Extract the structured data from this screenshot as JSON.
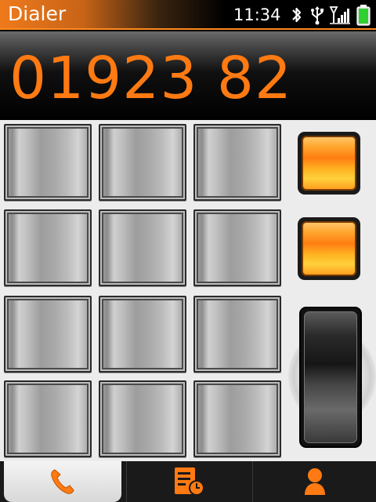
{
  "status_bar": {
    "title": "Dialer",
    "time": "11:34",
    "icons": [
      "bluetooth-icon",
      "usb-icon",
      "signal-icon",
      "battery-icon"
    ],
    "battery_color": "#2fd02f"
  },
  "display": {
    "number": "01923 82",
    "color": "#ff7a12"
  },
  "keypad": {
    "keys": [
      "",
      "",
      "",
      "",
      "",
      "",
      "",
      "",
      "",
      "",
      "",
      ""
    ]
  },
  "side_buttons": [
    "orange-button",
    "orange-button",
    "call-slider"
  ],
  "tabs": [
    {
      "name": "dialer",
      "icon": "phone-icon",
      "active": true
    },
    {
      "name": "call-log",
      "icon": "call-log-icon",
      "active": false
    },
    {
      "name": "contacts",
      "icon": "contact-icon",
      "active": false
    }
  ],
  "accent": "#ff7a12"
}
